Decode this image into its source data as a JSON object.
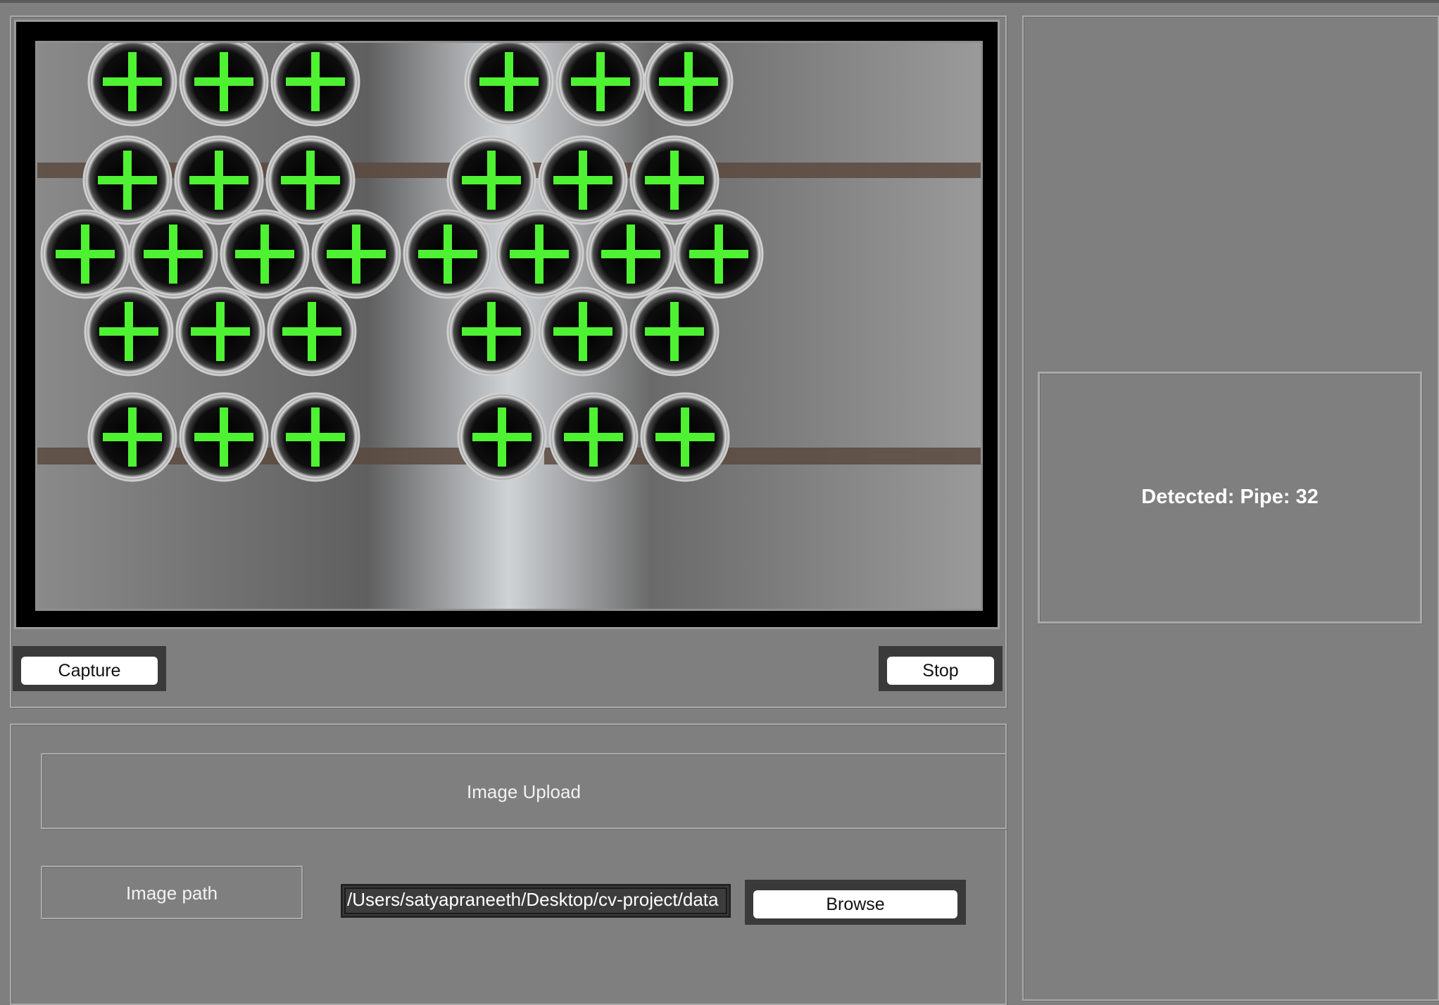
{
  "video": {
    "pipe_rows": [
      {
        "count": 6
      },
      {
        "count": 6
      },
      {
        "count": 8
      },
      {
        "count": 6
      },
      {
        "count": 6
      }
    ],
    "marker_color": "#4ef232"
  },
  "controls": {
    "capture_label": "Capture",
    "stop_label": "Stop"
  },
  "results": {
    "detected_text": "Detected: Pipe: 32"
  },
  "upload": {
    "title": "Image Upload",
    "path_label": "Image path",
    "path_value": "/Users/satyapraneeth/Desktop/cv-project/data",
    "browse_label": "Browse"
  }
}
